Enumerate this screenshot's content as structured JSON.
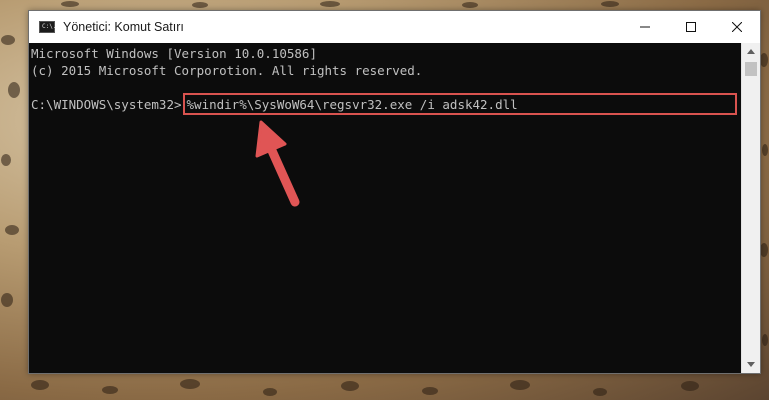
{
  "window": {
    "title": "Yönetici: Komut Satırı",
    "icon": "cmd-icon",
    "icon_text": "C:\\."
  },
  "console": {
    "lines": [
      "Microsoft Windows [Version 10.0.10586]",
      "(c) 2015 Microsoft Corporotion. All rights reserved."
    ],
    "prompt": "C:\\WINDOWS\\system32>",
    "command": "%windir%\\SysWoW64\\regsvr32.exe /i adsk42.dll"
  },
  "colors": {
    "highlight": "#d9534f",
    "arrow": "#e05555",
    "console_bg": "#0c0c0c",
    "console_text": "#c0c0c0"
  }
}
